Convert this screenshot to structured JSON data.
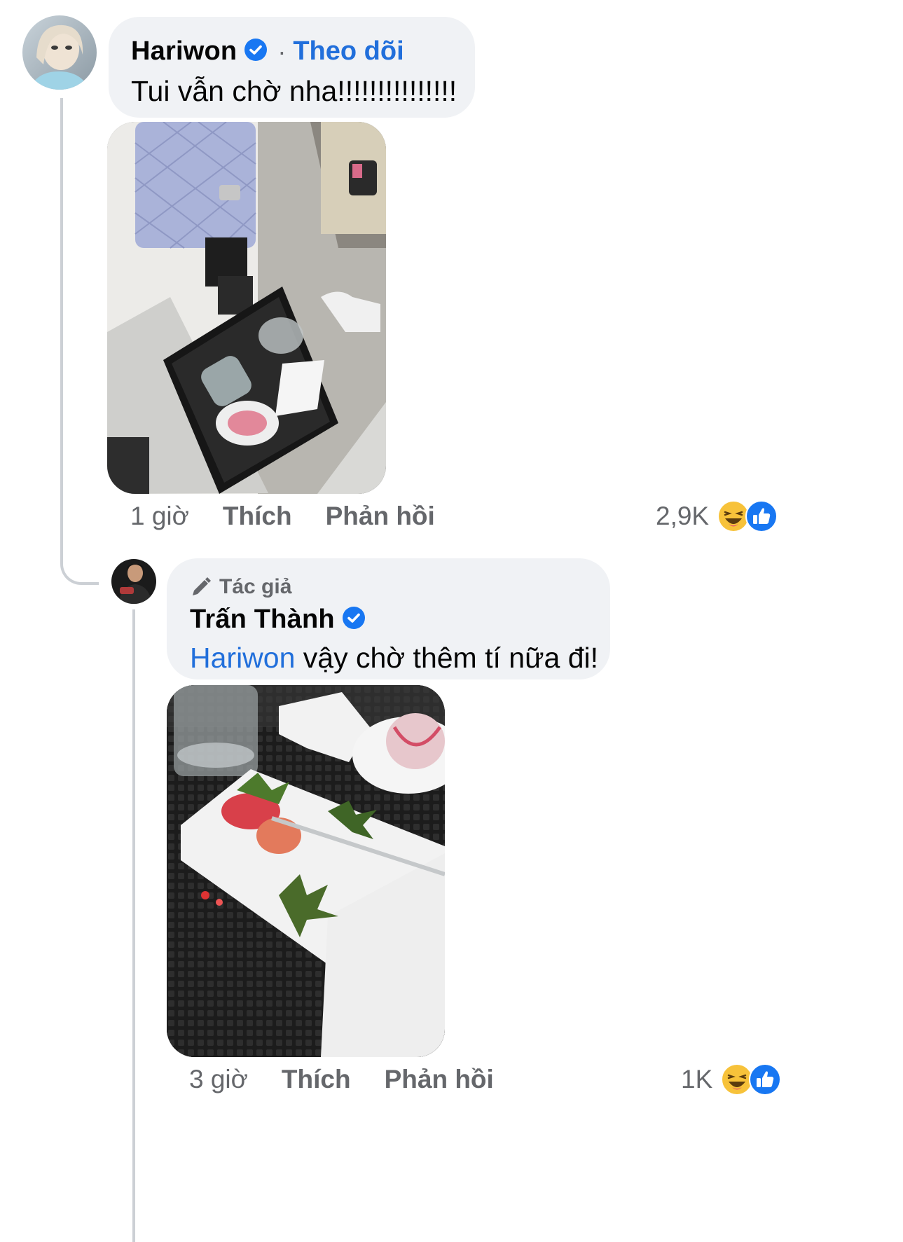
{
  "comments": [
    {
      "author": "Hariwon",
      "follow_label": "Theo dõi",
      "text": "Tui vẫn chờ nha!!!!!!!!!!!!!!!",
      "time": "1 giờ",
      "like_label": "Thích",
      "reply_label": "Phản hồi",
      "reaction_count": "2,9K",
      "reactions": [
        "haha-icon",
        "like-icon"
      ]
    }
  ],
  "reply": {
    "badge": "Tác giả",
    "author": "Trấn Thành",
    "mention": "Hariwon",
    "text": " vậy chờ thêm tí nữa đi!",
    "time": "3 giờ",
    "like_label": "Thích",
    "reply_label": "Phản hồi",
    "reaction_count": "1K",
    "reactions": [
      "haha-icon",
      "like-icon"
    ]
  },
  "colors": {
    "link": "#216fdb",
    "muted": "#65676b",
    "bubble": "#f0f2f5",
    "verified": "#1877f2",
    "haha": "#f7c23a",
    "like": "#1877f2"
  }
}
